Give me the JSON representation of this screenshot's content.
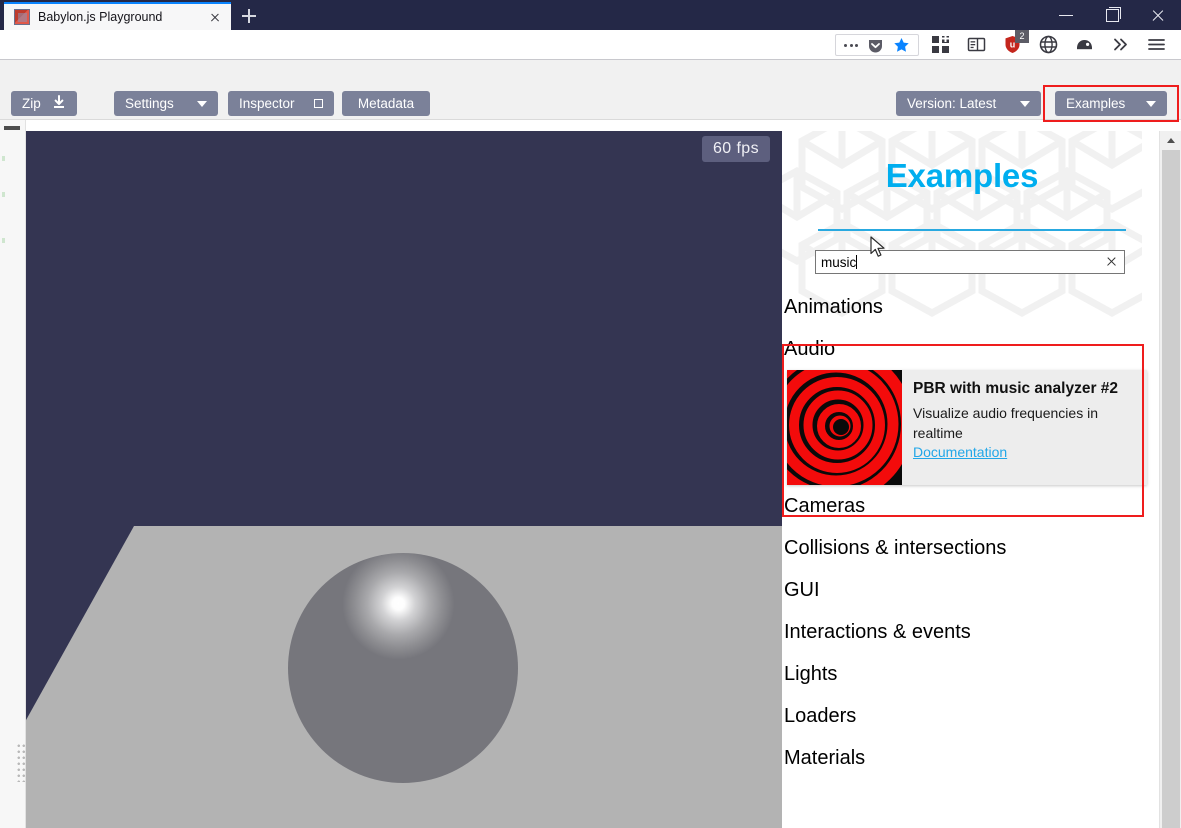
{
  "browser": {
    "tab": {
      "title": "Babylon.js Playground",
      "favicon": "babylon-logo-icon",
      "close": "close-tab-icon"
    },
    "new_tab_label": "+",
    "window_controls": {
      "minimize": "minimize-icon",
      "maximize": "restore-icon",
      "close": "close-window-icon"
    },
    "toolbar": {
      "overflow": "overflow-menu-icon",
      "pocket": "pocket-icon",
      "bookmark_star": "bookmark-star-icon",
      "extensions": [
        {
          "name": "apps-grid-icon"
        },
        {
          "name": "reader-view-icon"
        },
        {
          "name": "ublock-origin-icon",
          "badge": "2"
        },
        {
          "name": "globe-icon"
        },
        {
          "name": "mail-icon"
        },
        {
          "name": "chevrons-right-icon"
        },
        {
          "name": "hamburger-menu-icon"
        }
      ]
    }
  },
  "playground_toolbar": {
    "zip": "Zip",
    "settings": "Settings",
    "inspector": "Inspector",
    "metadata": "Metadata",
    "version": "Version: Latest",
    "examples": "Examples"
  },
  "viewport": {
    "fps": "60 fps",
    "background_color": "#343552",
    "ground_color": "#b3b3b3",
    "sphere_color": "#a9a9ac"
  },
  "examples_panel": {
    "heading": "Examples",
    "search": {
      "value": "music",
      "placeholder": "",
      "clear_icon": "clear-search-icon"
    },
    "accent_color": "#00aeef",
    "highlight_color": "#ef1d1d",
    "categories": [
      {
        "title": "Animations",
        "examples": []
      },
      {
        "title": "Audio",
        "examples": [
          {
            "title": "PBR with music analyzer #2",
            "description": "Visualize audio frequencies in realtime",
            "doc_link": "Documentation",
            "thumb": "red-concentric-rings-thumbnail"
          }
        ]
      },
      {
        "title": "Cameras",
        "examples": []
      },
      {
        "title": "Collisions & intersections",
        "examples": []
      },
      {
        "title": "GUI",
        "examples": []
      },
      {
        "title": "Interactions & events",
        "examples": []
      },
      {
        "title": "Lights",
        "examples": []
      },
      {
        "title": "Loaders",
        "examples": []
      },
      {
        "title": "Materials",
        "examples": []
      }
    ]
  }
}
